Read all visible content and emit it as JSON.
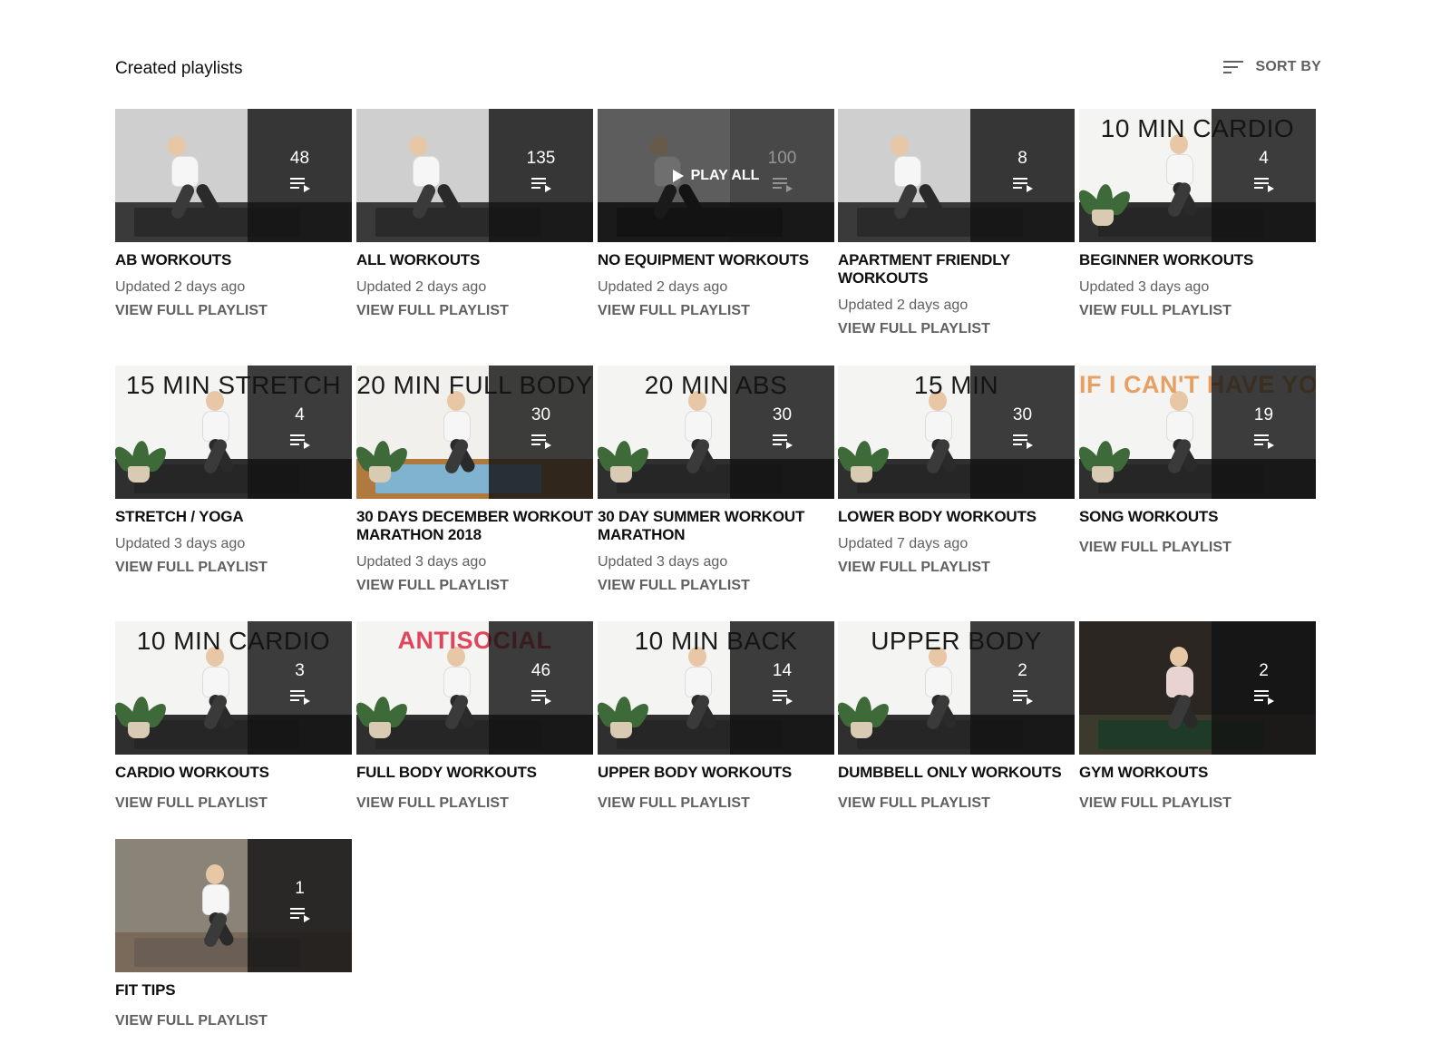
{
  "header": {
    "title": "Created playlists",
    "sort_label": "SORT BY"
  },
  "colors": {
    "text_primary": "#0f0f0f",
    "text_secondary": "#606060",
    "overlay": "#141414"
  },
  "playlists": [
    {
      "name": "AB WORKOUTS",
      "count": "48",
      "updated": "Updated 2 days ago",
      "view": "VIEW FULL PLAYLIST",
      "caption": "",
      "scene": "mat"
    },
    {
      "name": "ALL WORKOUTS",
      "count": "135",
      "updated": "Updated 2 days ago",
      "view": "VIEW FULL PLAYLIST",
      "caption": "",
      "scene": "mat"
    },
    {
      "name": "NO EQUIPMENT WORKOUTS",
      "count": "100",
      "updated": "Updated 2 days ago",
      "view": "VIEW FULL PLAYLIST",
      "caption": "",
      "scene": "mat",
      "hover_label": "PLAY ALL"
    },
    {
      "name": "APARTMENT FRIENDLY WORKOUTS",
      "count": "8",
      "updated": "Updated 2 days ago",
      "view": "VIEW FULL PLAYLIST",
      "caption": "",
      "scene": "mat"
    },
    {
      "name": "BEGINNER WORKOUTS",
      "count": "4",
      "updated": "Updated 3 days ago",
      "view": "VIEW FULL PLAYLIST",
      "caption": "10 MIN CARDIO",
      "scene": "studio"
    },
    {
      "name": "STRETCH / YOGA",
      "count": "4",
      "updated": "Updated 3 days ago",
      "view": "VIEW FULL PLAYLIST",
      "caption": "15 MIN STRETCH",
      "scene": "studio"
    },
    {
      "name": "30 DAYS DECEMBER WORKOUT MARATHON 2018",
      "count": "30",
      "updated": "Updated 3 days ago",
      "view": "VIEW FULL PLAYLIST",
      "caption": "20 MIN FULL BODY",
      "scene": "room"
    },
    {
      "name": "30 DAY SUMMER WORKOUT MARATHON",
      "count": "30",
      "updated": "Updated 3 days ago",
      "view": "VIEW FULL PLAYLIST",
      "caption": "20 MIN ABS",
      "scene": "studio"
    },
    {
      "name": "LOWER BODY WORKOUTS",
      "count": "30",
      "updated": "Updated 7 days ago",
      "view": "VIEW FULL PLAYLIST",
      "caption": "15 MIN",
      "scene": "studio"
    },
    {
      "name": "SONG WORKOUTS",
      "count": "19",
      "updated": "",
      "view": "VIEW FULL PLAYLIST",
      "caption": "IF I CAN'T HAVE YOU",
      "caption_color": "#e8a062",
      "scene": "studio"
    },
    {
      "name": "CARDIO WORKOUTS",
      "count": "3",
      "updated": "",
      "view": "VIEW FULL PLAYLIST",
      "caption": "10 MIN CARDIO",
      "scene": "studio"
    },
    {
      "name": "FULL BODY WORKOUTS",
      "count": "46",
      "updated": "",
      "view": "VIEW FULL PLAYLIST",
      "caption": "ANTISOCIAL",
      "caption_color": "#e0455c",
      "scene": "studio"
    },
    {
      "name": "UPPER BODY WORKOUTS",
      "count": "14",
      "updated": "",
      "view": "VIEW FULL PLAYLIST",
      "caption": "10 MIN BACK",
      "scene": "studio"
    },
    {
      "name": "DUMBBELL ONLY WORKOUTS",
      "count": "2",
      "updated": "",
      "view": "VIEW FULL PLAYLIST",
      "caption": "UPPER BODY",
      "scene": "bench"
    },
    {
      "name": "GYM WORKOUTS",
      "count": "2",
      "updated": "",
      "view": "VIEW FULL PLAYLIST",
      "caption": "",
      "scene": "gym"
    },
    {
      "name": "FIT TIPS",
      "count": "1",
      "updated": "",
      "view": "VIEW FULL PLAYLIST",
      "caption": "",
      "scene": "split"
    }
  ]
}
